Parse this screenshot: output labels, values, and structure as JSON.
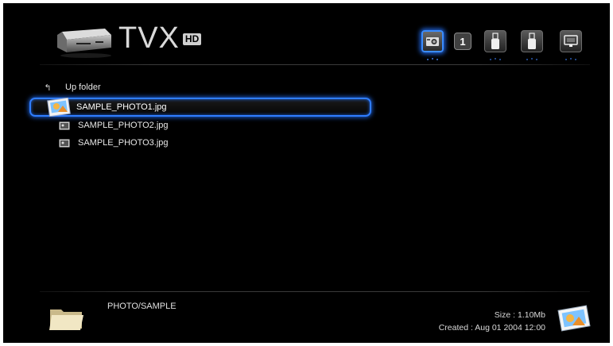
{
  "header": {
    "logo_text": "TVX",
    "logo_badge": "HD",
    "sources": [
      {
        "icon": "camera-icon",
        "selected": true
      },
      {
        "icon": "number-badge-icon",
        "label": "1"
      },
      {
        "icon": "usb-icon"
      },
      {
        "icon": "usb-icon"
      },
      {
        "icon": "network-display-icon"
      }
    ]
  },
  "browser": {
    "up_folder_label": "Up folder",
    "files": [
      {
        "name": "SAMPLE_PHOTO1.jpg",
        "selected": true
      },
      {
        "name": "SAMPLE_PHOTO2.jpg"
      },
      {
        "name": "SAMPLE_PHOTO3.jpg"
      }
    ]
  },
  "footer": {
    "path": "PHOTO/SAMPLE",
    "size": "Size : 1.10Mb",
    "created": "Created : Aug 01 2004   12:00"
  },
  "colors": {
    "background": "#000000",
    "highlight": "#2f7dff",
    "text": "#e8e8e8"
  }
}
